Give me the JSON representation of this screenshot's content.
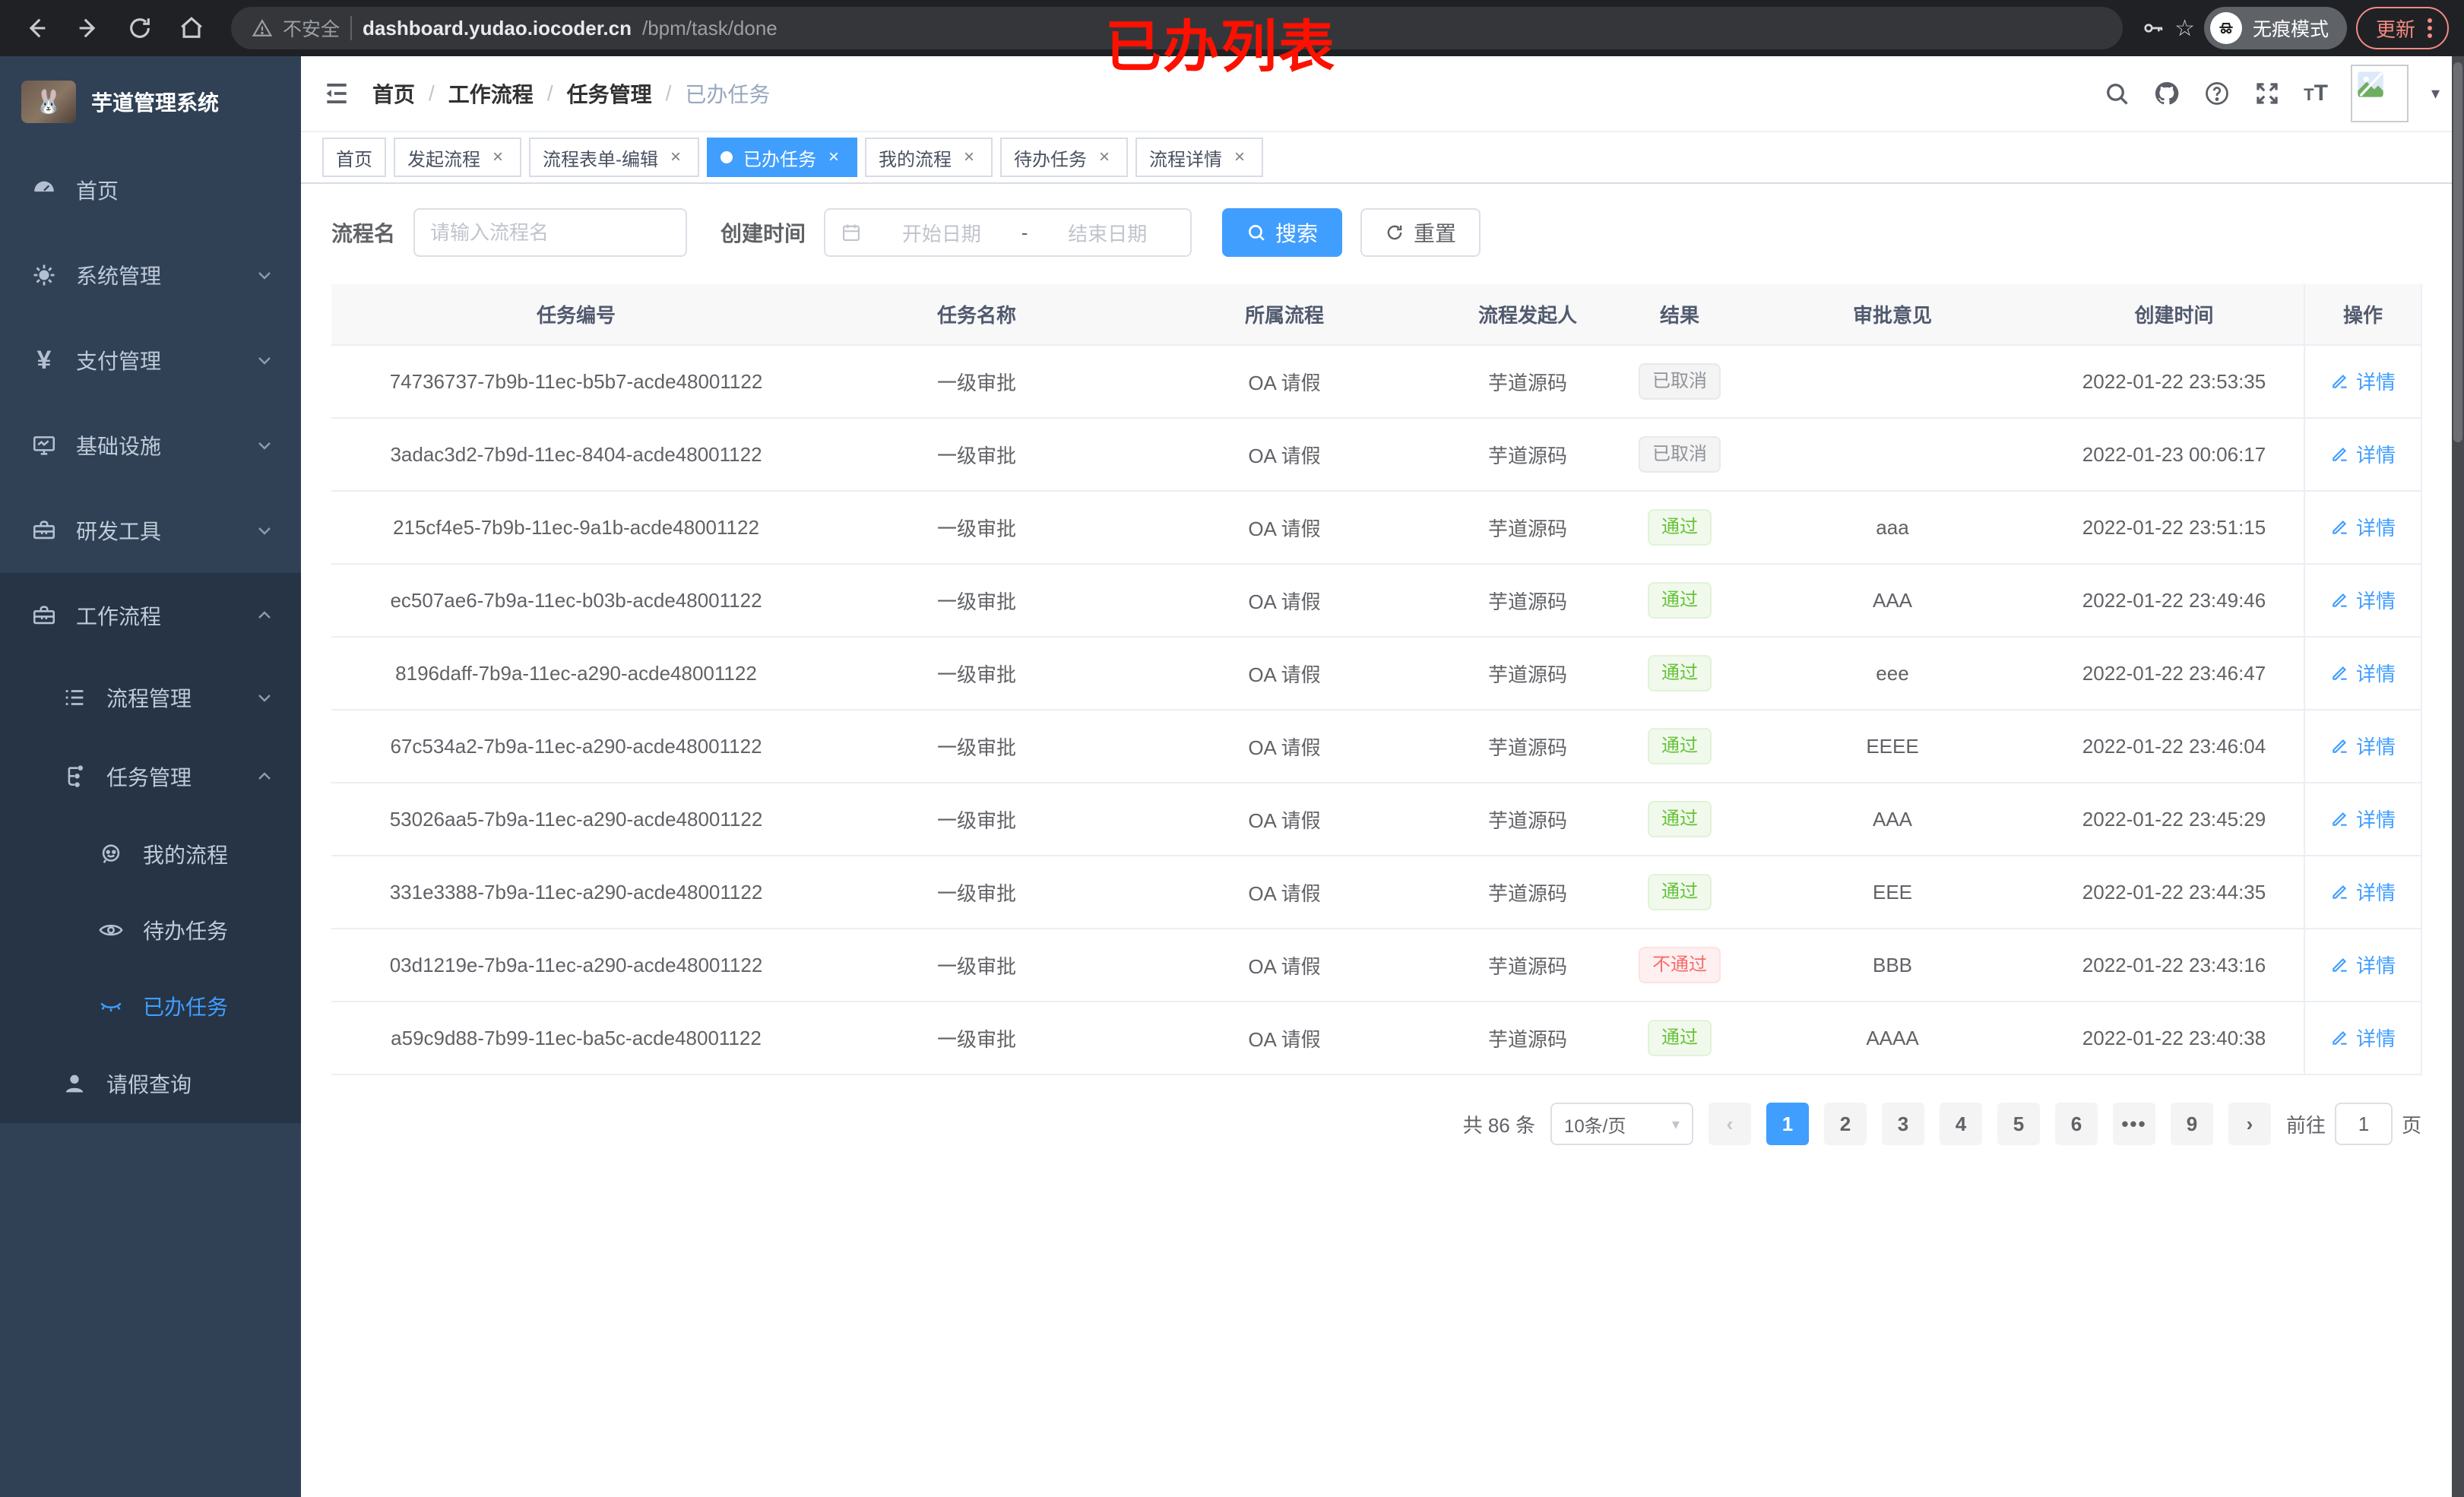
{
  "colors": {
    "accent": "#409EFF",
    "success": "#67C23A",
    "danger": "#F56C6C",
    "info": "#909399",
    "sidebar": "#304156",
    "annotation_red": "#FE1000"
  },
  "icons": {
    "close": "×",
    "ellipsis": "•••",
    "caret_down": "▾",
    "star": "☆"
  },
  "browser": {
    "security_label": "不安全",
    "url_host": "dashboard.yudao.iocoder.cn",
    "url_path": "/bpm/task/done",
    "incognito_label": "无痕模式",
    "update_label": "更新"
  },
  "annotation": {
    "text": "已办列表"
  },
  "sidebar": {
    "title": "芋道管理系统",
    "menu": {
      "home": "首页",
      "system": "系统管理",
      "payment": "支付管理",
      "infra": "基础设施",
      "devtools": "研发工具",
      "workflow": "工作流程",
      "process_mgmt": "流程管理",
      "task_mgmt": "任务管理",
      "my_process": "我的流程",
      "todo_tasks": "待办任务",
      "done_tasks": "已办任务",
      "leave_query": "请假查询"
    }
  },
  "navbar": {
    "separator": "/",
    "breadcrumb": [
      "首页",
      "工作流程",
      "任务管理",
      "已办任务"
    ]
  },
  "tabs": {
    "items": [
      "首页",
      "发起流程",
      "流程表单-编辑",
      "已办任务",
      "我的流程",
      "待办任务",
      "流程详情"
    ]
  },
  "filters": {
    "name_label": "流程名",
    "name_placeholder": "请输入流程名",
    "time_label": "创建时间",
    "start_placeholder": "开始日期",
    "range_separator": "-",
    "end_placeholder": "结束日期",
    "search_label": "搜索",
    "reset_label": "重置"
  },
  "table": {
    "columns": [
      "任务编号",
      "任务名称",
      "所属流程",
      "流程发起人",
      "结果",
      "审批意见",
      "创建时间",
      "操作"
    ],
    "action_label": "详情",
    "rows": [
      {
        "id": "74736737-7b9b-11ec-b5b7-acde48001122",
        "name": "一级审批",
        "process": "OA 请假",
        "starter": "芋道源码",
        "result": "已取消",
        "result_type": "info",
        "comment": "",
        "time": "2022-01-22 23:53:35"
      },
      {
        "id": "3adac3d2-7b9d-11ec-8404-acde48001122",
        "name": "一级审批",
        "process": "OA 请假",
        "starter": "芋道源码",
        "result": "已取消",
        "result_type": "info",
        "comment": "",
        "time": "2022-01-23 00:06:17"
      },
      {
        "id": "215cf4e5-7b9b-11ec-9a1b-acde48001122",
        "name": "一级审批",
        "process": "OA 请假",
        "starter": "芋道源码",
        "result": "通过",
        "result_type": "success",
        "comment": "aaa",
        "time": "2022-01-22 23:51:15"
      },
      {
        "id": "ec507ae6-7b9a-11ec-b03b-acde48001122",
        "name": "一级审批",
        "process": "OA 请假",
        "starter": "芋道源码",
        "result": "通过",
        "result_type": "success",
        "comment": "AAA",
        "time": "2022-01-22 23:49:46"
      },
      {
        "id": "8196daff-7b9a-11ec-a290-acde48001122",
        "name": "一级审批",
        "process": "OA 请假",
        "starter": "芋道源码",
        "result": "通过",
        "result_type": "success",
        "comment": "eee",
        "time": "2022-01-22 23:46:47"
      },
      {
        "id": "67c534a2-7b9a-11ec-a290-acde48001122",
        "name": "一级审批",
        "process": "OA 请假",
        "starter": "芋道源码",
        "result": "通过",
        "result_type": "success",
        "comment": "EEEE",
        "time": "2022-01-22 23:46:04"
      },
      {
        "id": "53026aa5-7b9a-11ec-a290-acde48001122",
        "name": "一级审批",
        "process": "OA 请假",
        "starter": "芋道源码",
        "result": "通过",
        "result_type": "success",
        "comment": "AAA",
        "time": "2022-01-22 23:45:29"
      },
      {
        "id": "331e3388-7b9a-11ec-a290-acde48001122",
        "name": "一级审批",
        "process": "OA 请假",
        "starter": "芋道源码",
        "result": "通过",
        "result_type": "success",
        "comment": "EEE",
        "time": "2022-01-22 23:44:35"
      },
      {
        "id": "03d1219e-7b9a-11ec-a290-acde48001122",
        "name": "一级审批",
        "process": "OA 请假",
        "starter": "芋道源码",
        "result": "不通过",
        "result_type": "danger",
        "comment": "BBB",
        "time": "2022-01-22 23:43:16"
      },
      {
        "id": "a59c9d88-7b99-11ec-ba5c-acde48001122",
        "name": "一级审批",
        "process": "OA 请假",
        "starter": "芋道源码",
        "result": "通过",
        "result_type": "success",
        "comment": "AAAA",
        "time": "2022-01-22 23:40:38"
      }
    ]
  },
  "pagination": {
    "total": "共 86 条",
    "page_size": "10条/页",
    "prev": "‹",
    "pages": [
      "1",
      "2",
      "3",
      "4",
      "5",
      "6",
      "9"
    ],
    "next": "›",
    "goto_label": "前往",
    "goto_value": "1",
    "goto_suffix": "页"
  }
}
